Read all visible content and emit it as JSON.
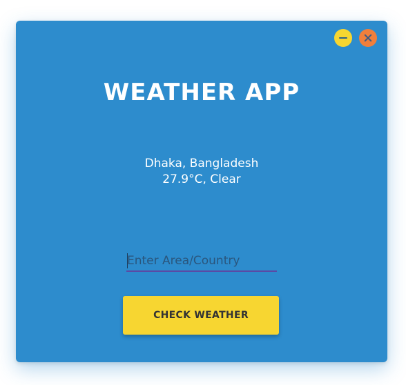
{
  "app": {
    "title": "WEATHER APP"
  },
  "window_controls": {
    "minimize_icon": "minimize-icon",
    "close_icon": "close-icon",
    "minimize_color": "#f7d631",
    "close_color": "#f07f3c"
  },
  "weather": {
    "location": "Dhaka, Bangladesh",
    "temperature": "27.9°C, Clear"
  },
  "search": {
    "value": "",
    "placeholder": "Enter Area/Country"
  },
  "actions": {
    "check_label": "CHECK WEATHER"
  },
  "colors": {
    "background": "#2d8ccd",
    "accent": "#f7d631",
    "underline": "#5a4aa5"
  }
}
